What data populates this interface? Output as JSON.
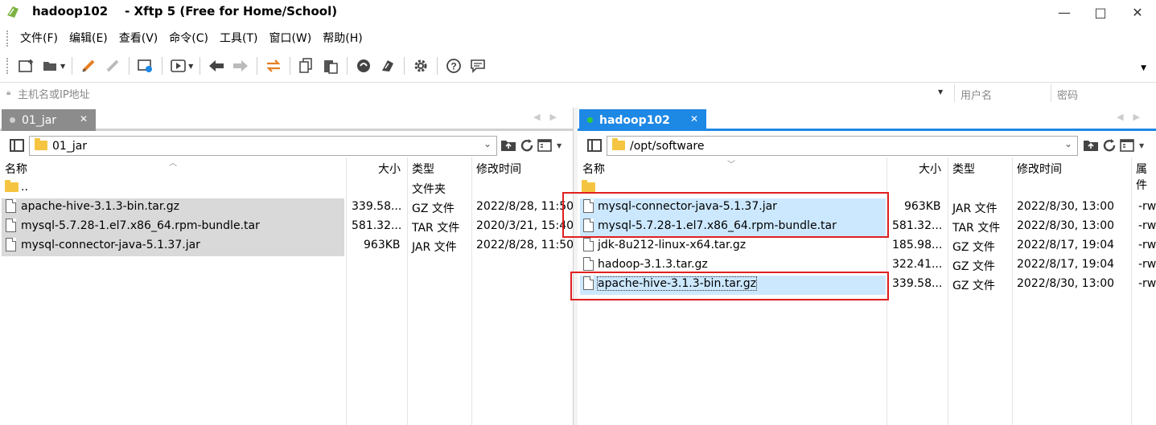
{
  "window": {
    "title": "hadoop102    - Xftp 5 (Free for Home/School)",
    "minimize": "—",
    "maximize": "□",
    "close": "✕"
  },
  "menu": [
    "文件(F)",
    "编辑(E)",
    "查看(V)",
    "命令(C)",
    "工具(T)",
    "窗口(W)",
    "帮助(H)"
  ],
  "address": {
    "host_placeholder": "主机名或IP地址",
    "user_placeholder": "用户名",
    "pass_placeholder": "密码"
  },
  "left_panel": {
    "tab_label": "01_jar",
    "path": "01_jar",
    "columns": {
      "name": "名称",
      "size": "大小",
      "type": "类型",
      "modified": "修改时间"
    },
    "rows": [
      {
        "name": "..",
        "size": "",
        "type": "文件夹",
        "modified": ""
      },
      {
        "name": "apache-hive-3.1.3-bin.tar.gz",
        "size": "339.58...",
        "type": "GZ 文件",
        "modified": "2022/8/28, 11:50"
      },
      {
        "name": "mysql-5.7.28-1.el7.x86_64.rpm-bundle.tar",
        "size": "581.32...",
        "type": "TAR 文件",
        "modified": "2020/3/21, 15:40"
      },
      {
        "name": "mysql-connector-java-5.1.37.jar",
        "size": "963KB",
        "type": "JAR 文件",
        "modified": "2022/8/28, 11:50"
      }
    ]
  },
  "right_panel": {
    "tab_label": "hadoop102",
    "path": "/opt/software",
    "columns": {
      "name": "名称",
      "size": "大小",
      "type": "类型",
      "modified": "修改时间",
      "attr": "属件"
    },
    "rows": [
      {
        "name": "",
        "size": "",
        "type": "",
        "modified": "",
        "attr": ""
      },
      {
        "name": "mysql-connector-java-5.1.37.jar",
        "size": "963KB",
        "type": "JAR 文件",
        "modified": "2022/8/30, 13:00",
        "attr": "-rw"
      },
      {
        "name": "mysql-5.7.28-1.el7.x86_64.rpm-bundle.tar",
        "size": "581.32...",
        "type": "TAR 文件",
        "modified": "2022/8/30, 13:00",
        "attr": "-rw"
      },
      {
        "name": "jdk-8u212-linux-x64.tar.gz",
        "size": "185.98...",
        "type": "GZ 文件",
        "modified": "2022/8/17, 19:04",
        "attr": "-rw"
      },
      {
        "name": "hadoop-3.1.3.tar.gz",
        "size": "322.41...",
        "type": "GZ 文件",
        "modified": "2022/8/17, 19:04",
        "attr": "-rw"
      },
      {
        "name": "apache-hive-3.1.3-bin.tar.gz",
        "size": "339.58...",
        "type": "GZ 文件",
        "modified": "2022/8/30, 13:00",
        "attr": "-rw"
      }
    ]
  },
  "icons": {
    "toolbar": [
      "new-session-icon",
      "open-folder-icon",
      "connect-icon",
      "disconnect-icon",
      "session-properties-icon",
      "transfer-icon",
      "back-icon",
      "forward-icon",
      "sync-icon",
      "copy-icon",
      "paste-icon",
      "xshell-icon",
      "xmanager-icon",
      "settings-icon",
      "help-icon",
      "chat-icon"
    ]
  },
  "colors": {
    "active_tab": "#1e88e5",
    "inactive_tab": "#8c8c8c",
    "selection_blue": "#cce8ff",
    "selection_gray": "#d9d9d9",
    "annotation_red": "#e02020",
    "folder": "#f5c542"
  }
}
